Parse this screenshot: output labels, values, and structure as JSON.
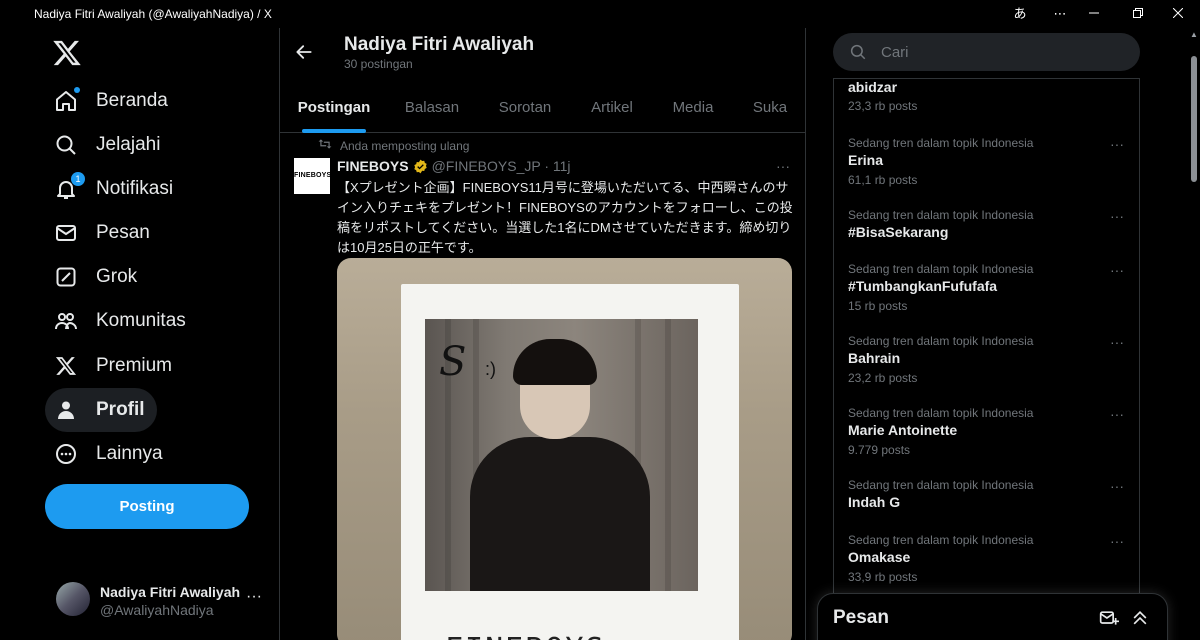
{
  "window": {
    "title": "Nadiya Fitri Awaliyah (@AwaliyahNadiya) / X",
    "translate_glyph": "あ",
    "more_glyph": "⋯"
  },
  "nav": {
    "items": [
      {
        "label": "Beranda",
        "icon": "home-icon"
      },
      {
        "label": "Jelajahi",
        "icon": "search-icon"
      },
      {
        "label": "Notifikasi",
        "icon": "bell-icon",
        "badge": "1"
      },
      {
        "label": "Pesan",
        "icon": "mail-icon"
      },
      {
        "label": "Grok",
        "icon": "grok-icon"
      },
      {
        "label": "Komunitas",
        "icon": "people-icon"
      },
      {
        "label": "Premium",
        "icon": "x-logo-icon"
      },
      {
        "label": "Profil",
        "icon": "person-icon",
        "active": true
      },
      {
        "label": "Lainnya",
        "icon": "more-circle-icon"
      }
    ],
    "post_button": "Posting"
  },
  "account": {
    "name": "Nadiya Fitri Awaliyah",
    "handle": "@AwaliyahNadiya",
    "more": "···"
  },
  "header": {
    "name": "Nadiya Fitri Awaliyah",
    "subtitle": "30 postingan"
  },
  "tabs": [
    "Postingan",
    "Balasan",
    "Sorotan",
    "Artikel",
    "Media",
    "Suka"
  ],
  "tweet": {
    "repost_label": "Anda memposting ulang",
    "avatar_text": "FINEBOYS",
    "name": "FINEBOYS",
    "handle_time": "@FINEBOYS_JP · 11j",
    "more": "···",
    "text": "【Xプレゼント企画】FINEBOYS11月号に登場いただいてる、中西瞬さんのサイン入りチェキをプレゼント！FINEBOYSのアカウントをフォローし、この投稿をリポストしてください。当選した1名にDMさせていただきます。締め切りは10月25日の正午です。",
    "photo_handwriting": "FINEBOYS",
    "photo_signature": "S",
    "photo_signature_mark": ":)"
  },
  "search": {
    "placeholder": "Cari"
  },
  "trends": [
    {
      "category": "",
      "title": "abidzar",
      "count": "23,3 rb posts"
    },
    {
      "category": "Sedang tren dalam topik Indonesia",
      "title": "Erina",
      "count": "61,1 rb posts"
    },
    {
      "category": "Sedang tren dalam topik Indonesia",
      "title": "#BisaSekarang",
      "count": ""
    },
    {
      "category": "Sedang tren dalam topik Indonesia",
      "title": "#TumbangkanFufufafa",
      "count": "15 rb posts"
    },
    {
      "category": "Sedang tren dalam topik Indonesia",
      "title": "Bahrain",
      "count": "23,2 rb posts"
    },
    {
      "category": "Sedang tren dalam topik Indonesia",
      "title": "Marie Antoinette",
      "count": "9.779 posts"
    },
    {
      "category": "Sedang tren dalam topik Indonesia",
      "title": "Indah G",
      "count": ""
    },
    {
      "category": "Sedang tren dalam topik Indonesia",
      "title": "Omakase",
      "count": "33,9 rb posts"
    }
  ],
  "trend_more": "···",
  "messages_dock": {
    "title": "Pesan"
  },
  "colors": {
    "accent": "#1d9bf0",
    "background": "#000000",
    "text": "#e7e9ea",
    "muted": "#71767b",
    "border": "#2f3336"
  }
}
